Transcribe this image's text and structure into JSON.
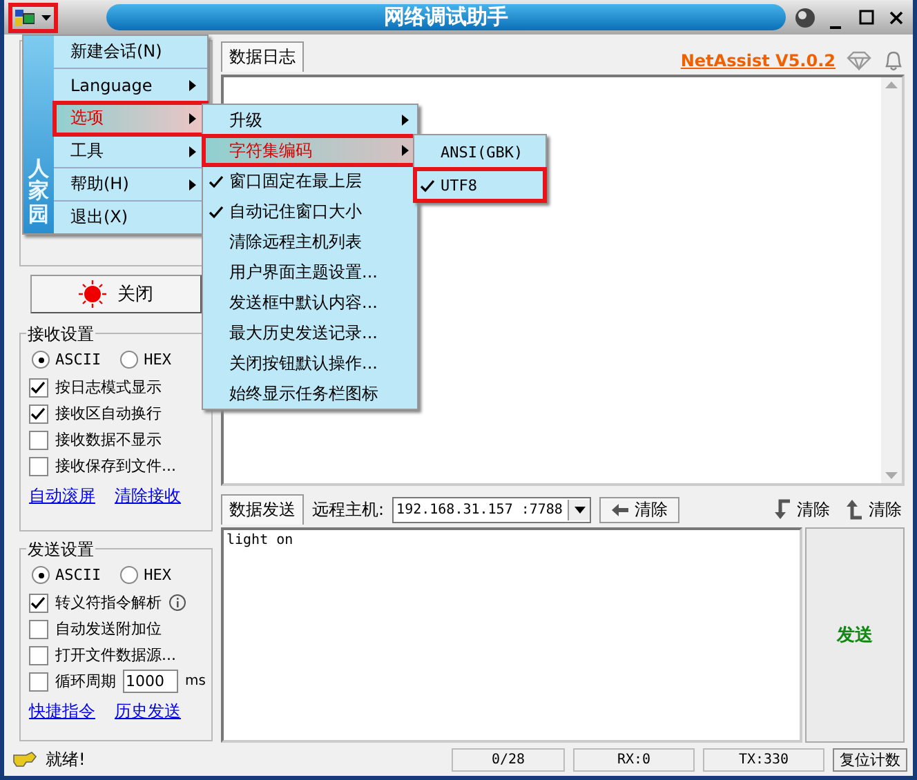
{
  "title_bar": {
    "title": "网络调试助手",
    "menu_button": {
      "highlighted": true
    }
  },
  "main_menu": {
    "banner": "人家园",
    "items": [
      {
        "label": "新建会话(N)",
        "has_submenu": false,
        "selected": false,
        "highlighted": false
      },
      {
        "label": "Language",
        "has_submenu": true,
        "selected": false,
        "highlighted": false
      },
      {
        "label": "选项",
        "has_submenu": true,
        "selected": true,
        "highlighted": true
      },
      {
        "label": "工具",
        "has_submenu": true,
        "selected": false,
        "highlighted": false
      },
      {
        "label": "帮助(H)",
        "has_submenu": true,
        "selected": false,
        "highlighted": false
      },
      {
        "label": "退出(X)",
        "has_submenu": false,
        "selected": false,
        "highlighted": false
      }
    ]
  },
  "options_submenu": {
    "items": [
      {
        "label": "升级",
        "has_submenu": true,
        "selected": false,
        "checked": false,
        "highlighted": false
      },
      {
        "label": "字符集编码",
        "has_submenu": true,
        "selected": true,
        "checked": false,
        "highlighted": true
      },
      {
        "label": "窗口固定在最上层",
        "has_submenu": false,
        "selected": false,
        "checked": true,
        "highlighted": false
      },
      {
        "label": "自动记住窗口大小",
        "has_submenu": false,
        "selected": false,
        "checked": true,
        "highlighted": false
      },
      {
        "label": "清除远程主机列表",
        "has_submenu": false,
        "selected": false,
        "checked": false,
        "highlighted": false
      },
      {
        "label": "用户界面主题设置...",
        "has_submenu": false,
        "selected": false,
        "checked": false,
        "highlighted": false
      },
      {
        "label": "发送框中默认内容...",
        "has_submenu": false,
        "selected": false,
        "checked": false,
        "highlighted": false
      },
      {
        "label": "最大历史发送记录...",
        "has_submenu": false,
        "selected": false,
        "checked": false,
        "highlighted": false
      },
      {
        "label": "关闭按钮默认操作...",
        "has_submenu": false,
        "selected": false,
        "checked": false,
        "highlighted": false
      },
      {
        "label": "始终显示任务栏图标",
        "has_submenu": false,
        "selected": false,
        "checked": false,
        "highlighted": false
      }
    ]
  },
  "charset_submenu": {
    "items": [
      {
        "label": "ANSI(GBK)",
        "checked": false,
        "highlighted": false
      },
      {
        "label": "UTF8",
        "checked": true,
        "highlighted": true
      }
    ]
  },
  "connection": {
    "button": "关闭"
  },
  "receive_settings": {
    "title": "接收设置",
    "encoding": [
      {
        "label": "ASCII",
        "selected": true
      },
      {
        "label": "HEX",
        "selected": false
      }
    ],
    "options": [
      {
        "kind": "plain",
        "label": "按日志模式显示",
        "checked": true
      },
      {
        "kind": "plain",
        "label": "接收区自动换行",
        "checked": true
      },
      {
        "kind": "plain",
        "label": "接收数据不显示",
        "checked": false
      },
      {
        "kind": "plain",
        "label": "接收保存到文件...",
        "checked": false
      }
    ],
    "links": [
      "自动滚屏",
      "清除接收"
    ]
  },
  "send_settings": {
    "title": "发送设置",
    "encoding": [
      {
        "label": "ASCII",
        "selected": true
      },
      {
        "label": "HEX",
        "selected": false
      }
    ],
    "options": [
      {
        "kind": "info",
        "label": "转义符指令解析",
        "checked": true
      },
      {
        "kind": "plain",
        "label": "自动发送附加位",
        "checked": false
      },
      {
        "kind": "plain",
        "label": "打开文件数据源...",
        "checked": false
      },
      {
        "kind": "period",
        "label": "循环周期",
        "checked": false,
        "value": "1000",
        "unit": "ms"
      }
    ],
    "links": [
      "快捷指令",
      "历史发送"
    ]
  },
  "log_panel": {
    "tab": "数据日志",
    "version_link": "NetAssist V5.0.2"
  },
  "send_panel": {
    "tab": "数据发送",
    "remote_label": "远程主机:",
    "remote_host": "192.168.31.157 :7788",
    "clear_buttons": [
      {
        "kind": "left-arrow",
        "label": "清除"
      },
      {
        "kind": "down-turn",
        "label": "清除"
      },
      {
        "kind": "up-turn",
        "label": "清除"
      }
    ],
    "message": "light on",
    "send_button": "发送"
  },
  "status_bar": {
    "status": "就绪!",
    "fields": [
      "0/28",
      "RX:0",
      "TX:330"
    ],
    "reset_button": "复位计数"
  }
}
